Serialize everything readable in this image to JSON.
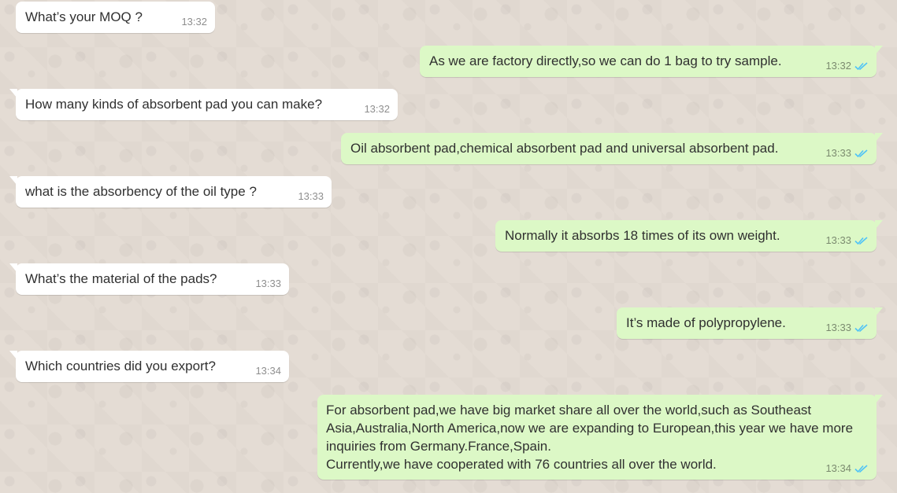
{
  "messages": [
    {
      "dir": "in",
      "text": "What’s your MOQ ?",
      "time": "13:32"
    },
    {
      "dir": "out",
      "text": "As we are factory directly,so we can do 1 bag to try sample.",
      "time": "13:32"
    },
    {
      "dir": "in",
      "text": "How many kinds of absorbent pad you can make?",
      "time": "13:32"
    },
    {
      "dir": "out",
      "text": "Oil absorbent pad,chemical absorbent pad and universal absorbent pad.",
      "time": "13:33"
    },
    {
      "dir": "in",
      "text": "what is the absorbency of the oil type ?",
      "time": "13:33"
    },
    {
      "dir": "out",
      "text": "Normally it absorbs 18 times of its own weight.",
      "time": "13:33"
    },
    {
      "dir": "in",
      "text": "What’s the material of the pads?",
      "time": "13:33"
    },
    {
      "dir": "out",
      "text": "It’s made of polypropylene.",
      "time": "13:33"
    },
    {
      "dir": "in",
      "text": "Which countries did you export?",
      "time": "13:34"
    },
    {
      "dir": "out",
      "text": "For absorbent pad,we have big market share all over the world,such as Southeast Asia,Australia,North America,now we are expanding to European,this year we have more inquiries from Germany.France,Spain.\nCurrently,we have cooperated with 76 countries all over the world.",
      "time": "13:34"
    }
  ],
  "colors": {
    "incoming_bubble": "#ffffff",
    "outgoing_bubble": "#dcf8c6",
    "read_ticks": "#4fc3f7",
    "wallpaper": "#e4dcd4"
  },
  "icons": {
    "read_receipt": "double-check-icon"
  }
}
